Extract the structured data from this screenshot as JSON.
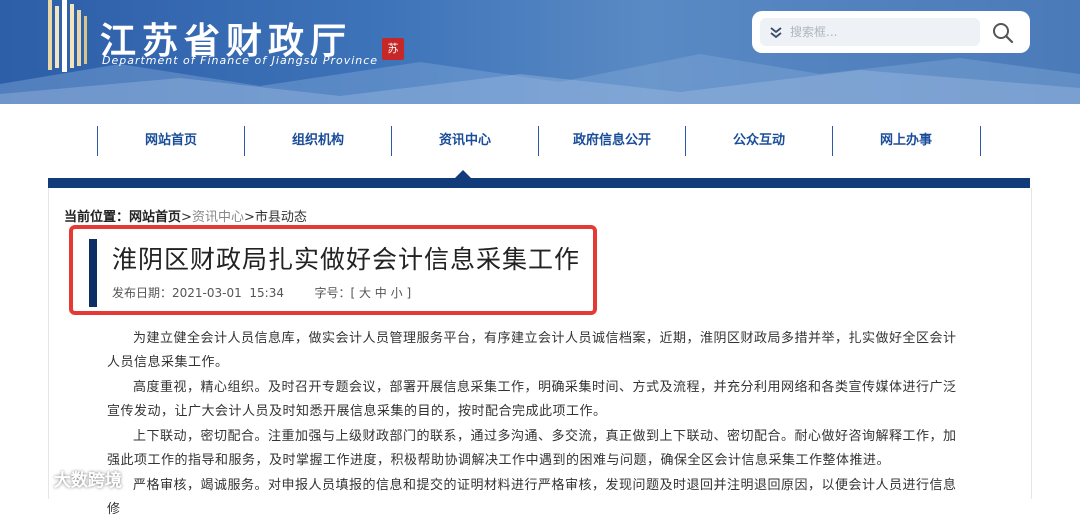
{
  "header": {
    "site_title": "江苏省财政厅",
    "site_subtitle": "Department of Finance of Jiangsu Province",
    "seal_text": "苏",
    "search": {
      "placeholder": "搜索框..."
    }
  },
  "nav": {
    "items": [
      {
        "label": "网站首页"
      },
      {
        "label": "组织机构"
      },
      {
        "label": "资讯中心"
      },
      {
        "label": "政府信息公开"
      },
      {
        "label": "公众互动"
      },
      {
        "label": "网上办事"
      }
    ],
    "active": "资讯中心"
  },
  "breadcrumb": {
    "prefix": "当前位置：",
    "home": "网站首页",
    "sep1": ">",
    "section": "资讯中心",
    "sep2": ">",
    "current": "市县动态"
  },
  "article": {
    "title": "淮阴区财政局扎实做好会计信息采集工作",
    "meta_date_label": "发布日期：",
    "meta_date": "2021-03-01  15:34",
    "meta_font_label": "字号：",
    "meta_font_sizes": "[ 大 中 小 ]",
    "paragraphs": [
      "为建立健全会计人员信息库，做实会计人员管理服务平台，有序建立会计人员诚信档案，近期，淮阴区财政局多措并举，扎实做好全区会计人员信息采集工作。",
      "高度重视，精心组织。及时召开专题会议，部署开展信息采集工作，明确采集时间、方式及流程，并充分利用网络和各类宣传媒体进行广泛宣传发动，让广大会计人员及时知悉开展信息采集的目的，按时配合完成此项工作。",
      "上下联动，密切配合。注重加强与上级财政部门的联系，通过多沟通、多交流，真正做到上下联动、密切配合。耐心做好咨询解释工作，加强此项工作的指导和服务，及时掌握工作进度，积极帮助协调解决工作中遇到的困难与问题，确保全区会计信息采集工作整体推进。",
      "严格审核，竭诚服务。对申报人员填报的信息和提交的证明材料进行严格审核，发现问题及时退回并注明退回原因，以便会计人员进行信息修"
    ]
  },
  "watermark": "大数跨境",
  "colors": {
    "banner": "#2d5ea8",
    "nav_text": "#1a4d99",
    "nav_bar": "#123b7a",
    "highlight_box": "#e53935",
    "title_accent": "#0d2f66"
  },
  "icons": [
    "chevron-down-icon",
    "search-icon",
    "logo-bars-icon",
    "mountain-graphic",
    "watermark-logo-icon"
  ]
}
